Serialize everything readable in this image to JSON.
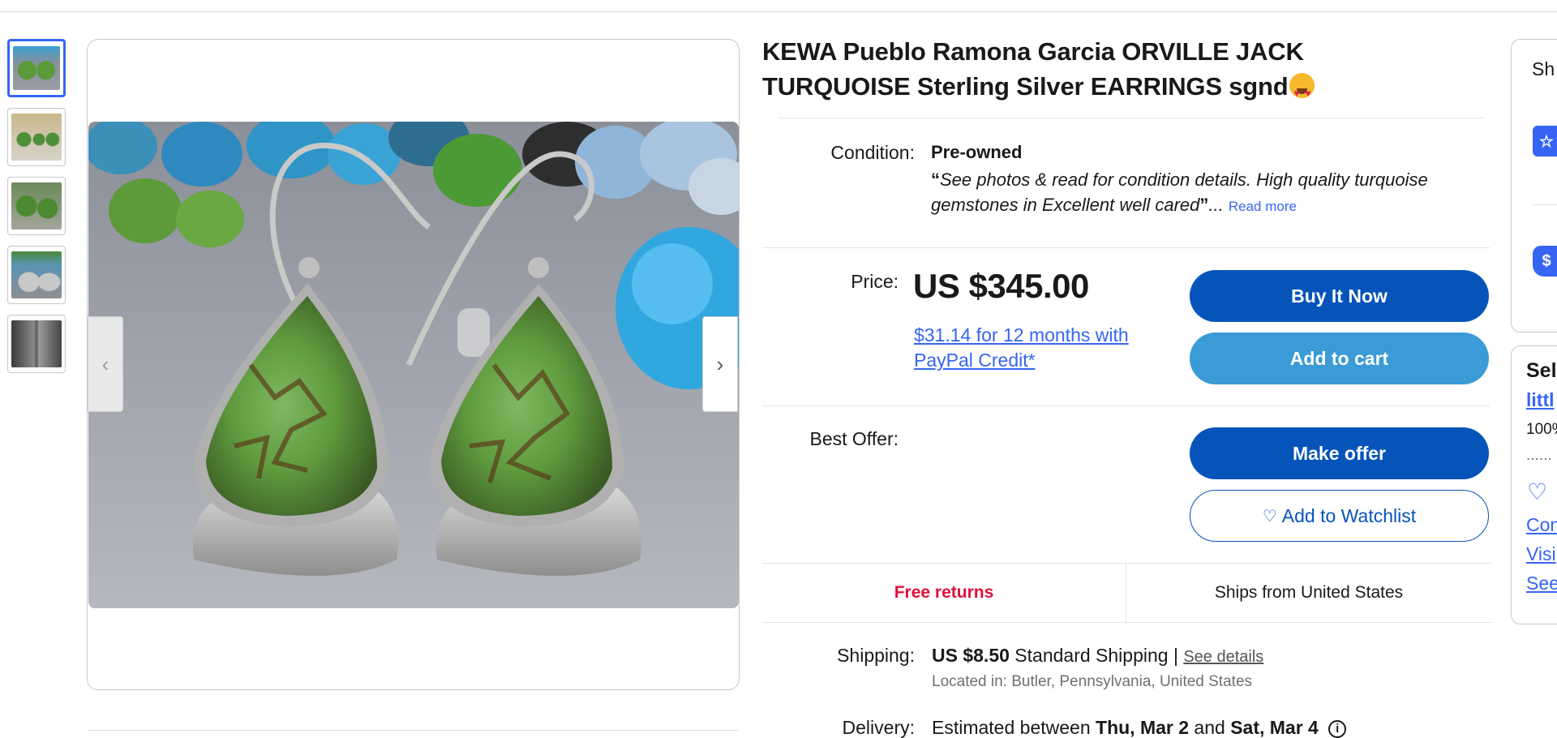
{
  "title": "KEWA Pueblo Ramona Garcia ORVILLE JACK TURQUOISE Sterling Silver EARRINGS sgnd",
  "condition": {
    "label": "Condition:",
    "value": "Pre-owned",
    "quote_open": "“",
    "description": "See photos & read for condition details. High quality turquoise gemstones in Excellent well cared",
    "quote_close": "”",
    "ellipsis": "...",
    "read_more": "Read more"
  },
  "price": {
    "label": "Price:",
    "value": "US $345.00",
    "credit_offer": "$31.14 for 12 months with PayPal Credit*"
  },
  "buttons": {
    "buy_now": "Buy It Now",
    "add_to_cart": "Add to cart",
    "make_offer": "Make offer",
    "watchlist": "Add to Watchlist"
  },
  "best_offer": {
    "label": "Best Offer:"
  },
  "returns": {
    "free_returns": "Free returns",
    "ships_from": "Ships from United States"
  },
  "shipping": {
    "label": "Shipping:",
    "cost": "US $8.50",
    "method": "Standard Shipping |",
    "see_details": "See details",
    "located": "Located in: Butler, Pennsylvania, United States"
  },
  "delivery": {
    "label": "Delivery:",
    "prefix": "Estimated between",
    "start": "Thu, Mar 2",
    "and": "and",
    "end": "Sat, Mar 4",
    "info_icon": "i"
  },
  "sidebar": {
    "card1_heading": "Sh",
    "card1_icons": [
      "star-badge-icon",
      "dollar-shield-icon"
    ],
    "card2_heading": "Sel",
    "seller_link": "littl",
    "feedback": "100%",
    "dots": "......",
    "links": [
      "Con",
      "Visi",
      "See"
    ]
  },
  "icons": {
    "prev": "chevron-left-icon",
    "next": "chevron-right-icon",
    "heart": "heart-outline-icon"
  },
  "colors": {
    "primary": "#0654ba",
    "secondary": "#3a9bd6",
    "link": "#3665f3",
    "free_returns": "#e0103a"
  },
  "thumbnails": [
    "thumb-1",
    "thumb-2",
    "thumb-3",
    "thumb-4",
    "thumb-5"
  ]
}
